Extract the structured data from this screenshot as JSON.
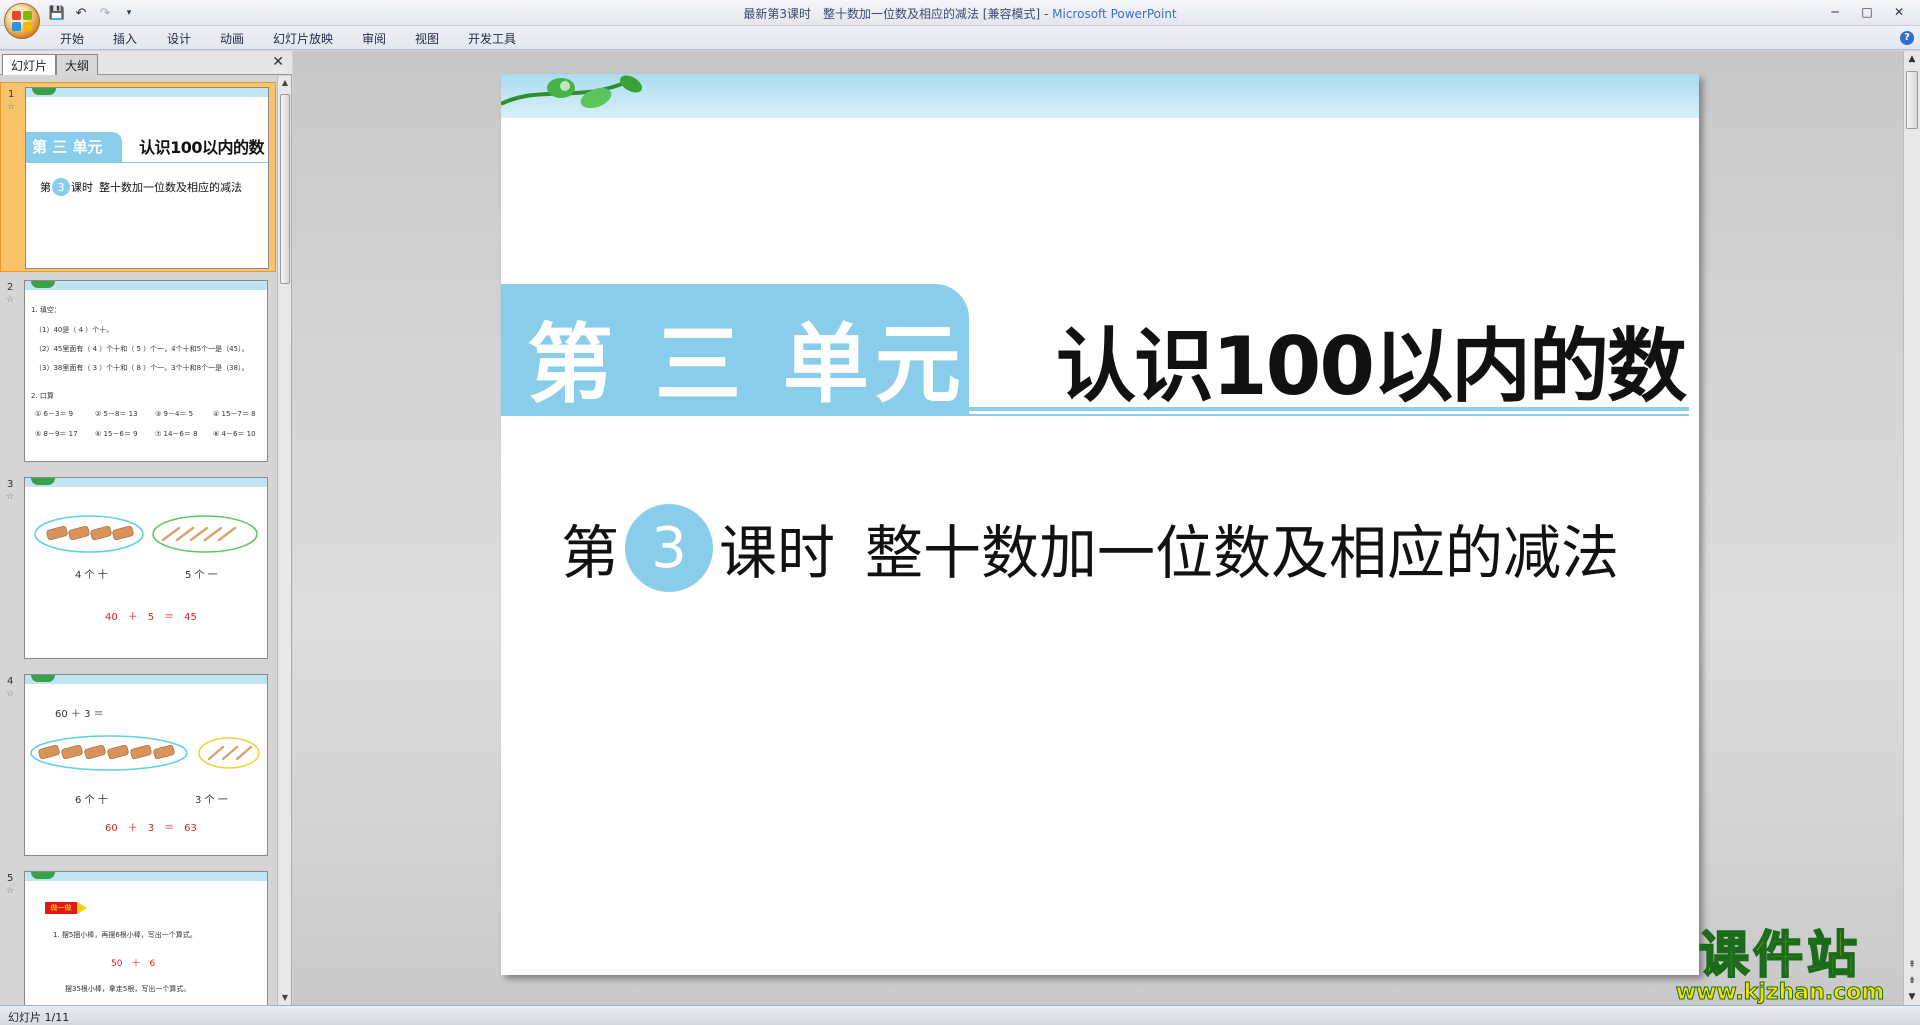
{
  "window": {
    "title_doc": "最新第3课时　整十数加一位数及相应的减法 [兼容模式]",
    "title_sep": " - ",
    "title_app": "Microsoft PowerPoint",
    "minimize": "─",
    "maximize": "□",
    "close": "✕"
  },
  "ribbon_tabs": [
    "开始",
    "插入",
    "设计",
    "动画",
    "幻灯片放映",
    "审阅",
    "视图",
    "开发工具"
  ],
  "pane_tabs": {
    "slides": "幻灯片",
    "outline": "大纲",
    "close": "✕"
  },
  "thumbnails": [
    {
      "num": "1",
      "unit": "第 三 单元",
      "title": "认识100以内的数",
      "lesson_pre": "第",
      "lesson_num": "3",
      "lesson_post": "课时",
      "lesson_name": "整十数加一位数及相应的减法"
    },
    {
      "num": "2",
      "lines": [
        "1. 填空：",
        "（1）40是（ 4 ）个十。",
        "（2）45里面有（ 4 ）个十和（ 5 ）个一，4个十和5个一是（45）。",
        "（3）38里面有（ 3 ）个十和（ 8 ）个一，3个十和8个一是（38）。",
        "2. 口算"
      ],
      "calc_row1": [
        "① 6－3＝ 9",
        "② 5－8＝ 13",
        "③ 9－4＝ 5",
        "④ 15－7＝ 8"
      ],
      "calc_row2": [
        "⑤ 8－9＝ 17",
        "⑥ 15－6＝ 9",
        "⑦ 14－6＝ 8",
        "⑧ 4－6＝ 10"
      ]
    },
    {
      "num": "3",
      "left_label": "4 个 十",
      "right_label": "5 个 一",
      "equation": "40　＋　5　＝　45"
    },
    {
      "num": "4",
      "question": "60 ＋ 3 ＝",
      "left_label": "6 个 十",
      "right_label": "3 个 一",
      "equation": "60　＋　3　＝　63"
    },
    {
      "num": "5",
      "tag": "做一做",
      "line1": "1. 摆5捆小棒，再摆6根小棒，写出一个算式。",
      "answer": "50　＋　6",
      "line2": "摆35根小棒，拿走5根，写出一个算式。"
    }
  ],
  "slide": {
    "unit": "第 三 单元",
    "title": "认识100以内的数",
    "lesson_pre": "第",
    "lesson_num": "3",
    "lesson_post": "课时",
    "lesson_name": "整十数加一位数及相应的减法"
  },
  "status": {
    "slide_info": "幻灯片 1/11"
  },
  "watermark": {
    "name": "课件站",
    "url": "www.kjzhan.com"
  },
  "colors": {
    "accent_blue": "#89cdea",
    "selected_thumb": "#f9c36b",
    "watermark_yellow": "#f6e100"
  }
}
